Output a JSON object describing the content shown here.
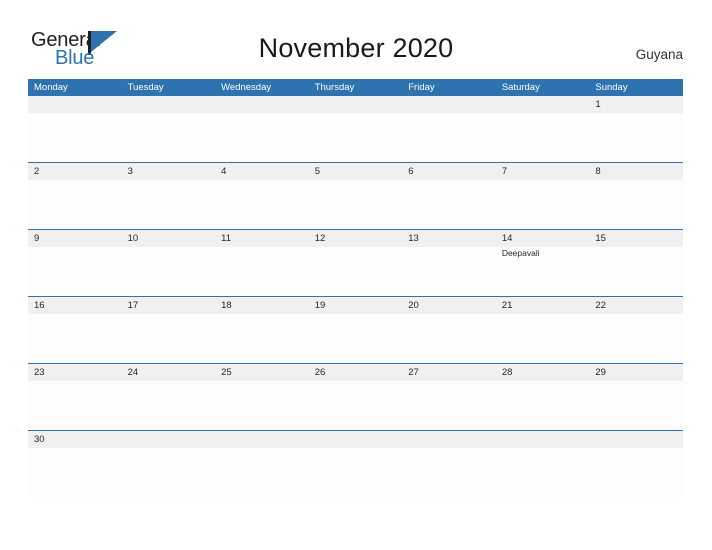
{
  "brand": {
    "name_part1": "General",
    "name_part2": "Blue",
    "flag_icon": "flag-triangle-icon",
    "color_dark": "#231f20",
    "color_blue": "#2e72b0"
  },
  "header": {
    "title": "November 2020",
    "country": "Guyana"
  },
  "theme": {
    "header_blue": "#2e72b0",
    "rule_blue": "#2e72b0",
    "number_band_gray": "#f0f0f0",
    "page_background": "#ffffff",
    "text_dark": "#262626"
  },
  "calendar": {
    "month": "November",
    "year": "2020",
    "weekday_headers": [
      "Monday",
      "Tuesday",
      "Wednesday",
      "Thursday",
      "Friday",
      "Saturday",
      "Sunday"
    ],
    "weeks": [
      {
        "days": [
          {
            "date": "",
            "events": []
          },
          {
            "date": "",
            "events": []
          },
          {
            "date": "",
            "events": []
          },
          {
            "date": "",
            "events": []
          },
          {
            "date": "",
            "events": []
          },
          {
            "date": "",
            "events": []
          },
          {
            "date": "1",
            "events": []
          }
        ]
      },
      {
        "days": [
          {
            "date": "2",
            "events": []
          },
          {
            "date": "3",
            "events": []
          },
          {
            "date": "4",
            "events": []
          },
          {
            "date": "5",
            "events": []
          },
          {
            "date": "6",
            "events": []
          },
          {
            "date": "7",
            "events": []
          },
          {
            "date": "8",
            "events": []
          }
        ]
      },
      {
        "days": [
          {
            "date": "9",
            "events": []
          },
          {
            "date": "10",
            "events": []
          },
          {
            "date": "11",
            "events": []
          },
          {
            "date": "12",
            "events": []
          },
          {
            "date": "13",
            "events": []
          },
          {
            "date": "14",
            "events": [
              "Deepavali"
            ]
          },
          {
            "date": "15",
            "events": []
          }
        ]
      },
      {
        "days": [
          {
            "date": "16",
            "events": []
          },
          {
            "date": "17",
            "events": []
          },
          {
            "date": "18",
            "events": []
          },
          {
            "date": "19",
            "events": []
          },
          {
            "date": "20",
            "events": []
          },
          {
            "date": "21",
            "events": []
          },
          {
            "date": "22",
            "events": []
          }
        ]
      },
      {
        "days": [
          {
            "date": "23",
            "events": []
          },
          {
            "date": "24",
            "events": []
          },
          {
            "date": "25",
            "events": []
          },
          {
            "date": "26",
            "events": []
          },
          {
            "date": "27",
            "events": []
          },
          {
            "date": "28",
            "events": []
          },
          {
            "date": "29",
            "events": []
          }
        ]
      },
      {
        "days": [
          {
            "date": "30",
            "events": []
          },
          {
            "date": "",
            "events": []
          },
          {
            "date": "",
            "events": []
          },
          {
            "date": "",
            "events": []
          },
          {
            "date": "",
            "events": []
          },
          {
            "date": "",
            "events": []
          },
          {
            "date": "",
            "events": []
          }
        ]
      }
    ]
  }
}
